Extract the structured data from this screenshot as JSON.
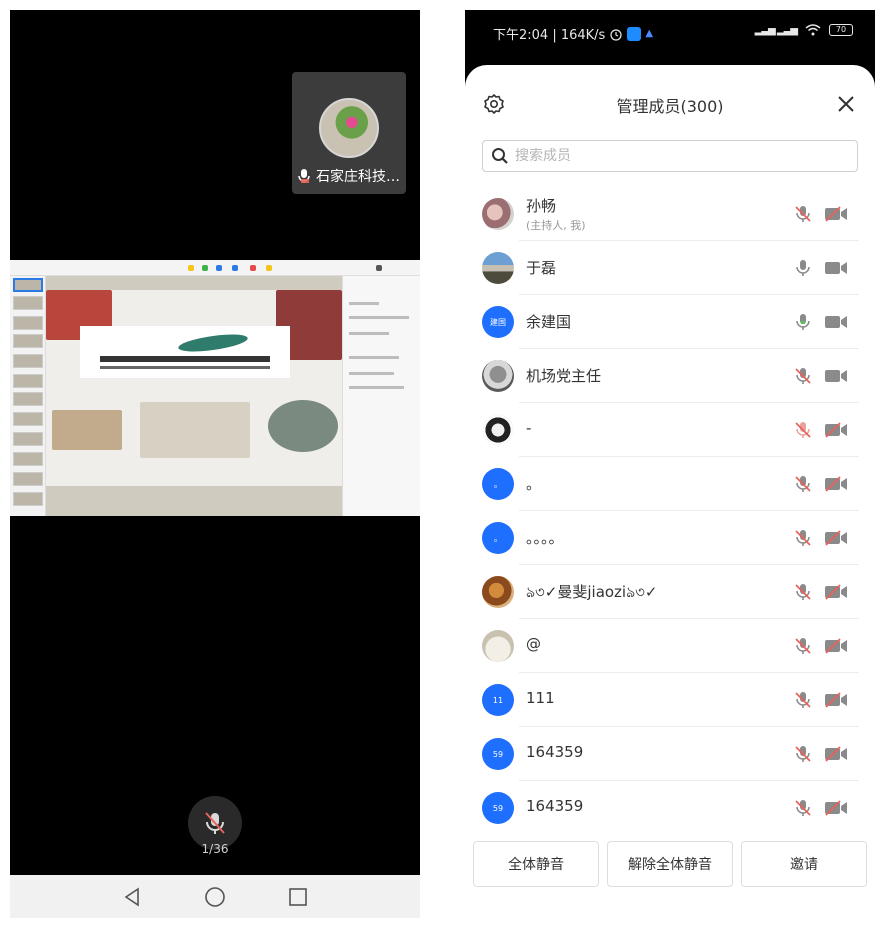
{
  "meeting": {
    "speaker_tile": {
      "name": "石家庄科技…",
      "avatar": "flower-photo-avatar"
    },
    "shared_screen": {
      "content": "presentation-slide-preview"
    },
    "mic_button": {
      "state": "muted",
      "icon": "mic-muted-icon"
    },
    "page_indicator": "1/36"
  },
  "android_nav": {
    "back_icon": "triangle-back-icon",
    "home_icon": "circle-home-icon",
    "recents_icon": "square-recents-icon"
  },
  "status_bar": {
    "time_speed": "下午2:04 | 164K/s",
    "alarm_icon": "alarm-icon",
    "battery": "70"
  },
  "members_panel": {
    "title": "管理成员(300)",
    "settings_icon": "gear-icon",
    "close_icon": "close-icon",
    "search": {
      "placeholder": "搜索成员",
      "icon": "search-icon"
    },
    "members": [
      {
        "name": "孙畅",
        "role": "(主持人, 我)",
        "avatar": "photo",
        "avatar_text": "",
        "mic": "muted",
        "cam": "off"
      },
      {
        "name": "于磊",
        "role": "",
        "avatar": "photo",
        "avatar_text": "",
        "mic": "on",
        "cam": "on"
      },
      {
        "name": "余建国",
        "role": "",
        "avatar": "initials",
        "avatar_text": "建国",
        "mic": "on",
        "cam": "on"
      },
      {
        "name": "机场党主任",
        "role": "",
        "avatar": "photo",
        "avatar_text": "",
        "mic": "muted",
        "cam": "on"
      },
      {
        "name": "-",
        "role": "",
        "avatar": "photo",
        "avatar_text": "",
        "mic": "muted-red",
        "cam": "off"
      },
      {
        "name": "。",
        "role": "",
        "avatar": "initials",
        "avatar_text": "。",
        "mic": "muted",
        "cam": "off"
      },
      {
        "name": "。。。。",
        "role": "",
        "avatar": "initials",
        "avatar_text": "。",
        "mic": "muted",
        "cam": "off"
      },
      {
        "name": "ঌ৩✓曼斐jiaoziঌ৩✓",
        "role": "",
        "avatar": "photo",
        "avatar_text": "",
        "mic": "muted",
        "cam": "off"
      },
      {
        "name": "@",
        "role": "",
        "avatar": "photo",
        "avatar_text": "",
        "mic": "muted",
        "cam": "off"
      },
      {
        "name": "111",
        "role": "",
        "avatar": "initials",
        "avatar_text": "11",
        "mic": "muted",
        "cam": "off"
      },
      {
        "name": "164359",
        "role": "",
        "avatar": "initials",
        "avatar_text": "59",
        "mic": "muted",
        "cam": "off"
      },
      {
        "name": "164359",
        "role": "",
        "avatar": "initials",
        "avatar_text": "59",
        "mic": "muted",
        "cam": "off"
      }
    ],
    "actions": {
      "mute_all": "全体静音",
      "unmute_all": "解除全体静音",
      "invite": "邀请"
    }
  },
  "colors": {
    "accent_blue": "#1f6fff",
    "muted_red": "#e9635a",
    "icon_gray": "#8a8a8a"
  }
}
